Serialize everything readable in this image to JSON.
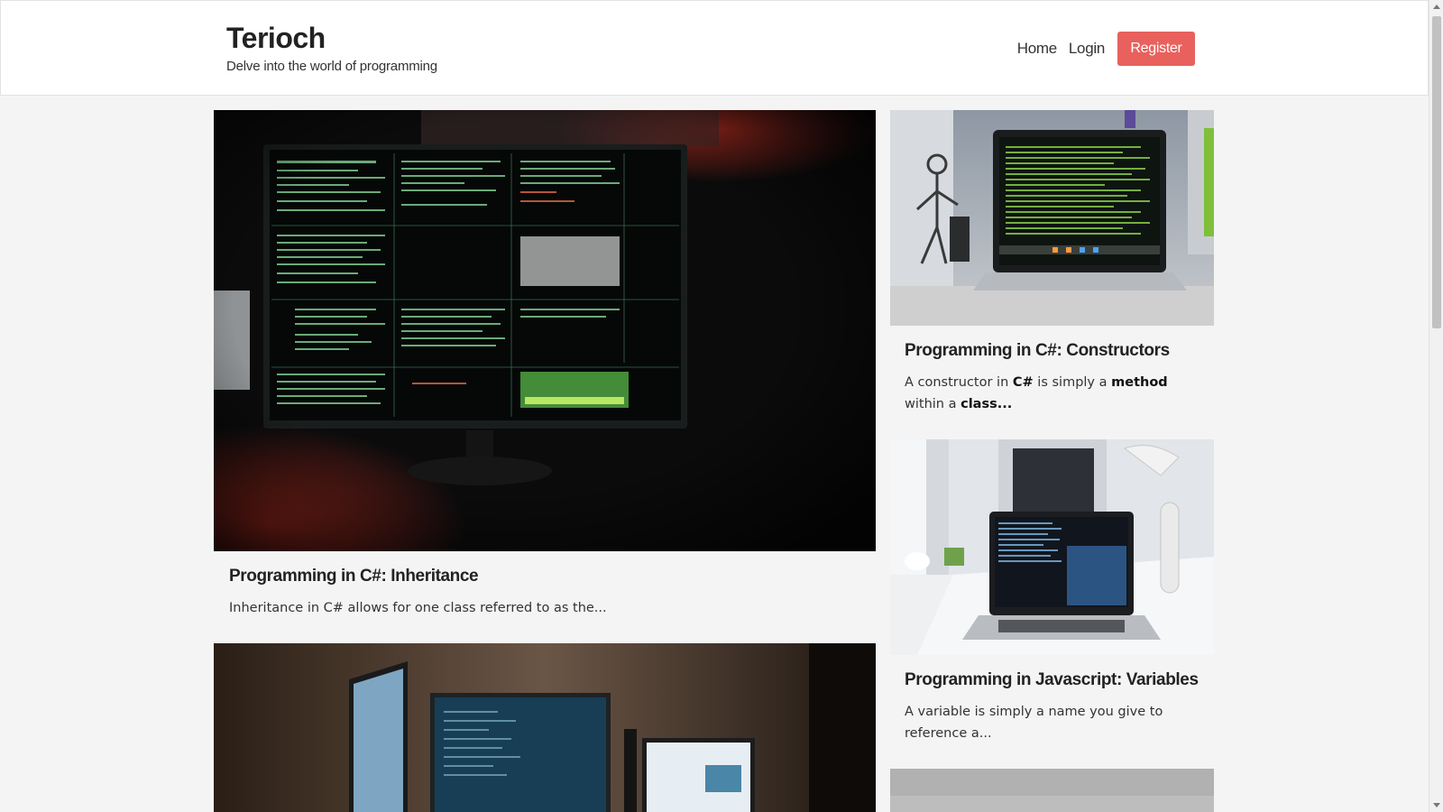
{
  "site": {
    "title": "Terioch",
    "tagline": "Delve into the world of programming"
  },
  "nav": {
    "home": "Home",
    "login": "Login",
    "register": "Register"
  },
  "colors": {
    "accent": "#e8615d",
    "background": "#f4f4f4"
  },
  "posts": [
    {
      "title": "Programming in C#: Inheritance",
      "excerpt": "Inheritance in C# allows for one class referred to as the...",
      "image_icon": "monitor-terminal-photo"
    },
    {
      "title": "Programming in C#: Constructors",
      "excerpt_parts": {
        "p1": "A constructor in ",
        "b1": "C#",
        "p2": " is simply a ",
        "b2": "method",
        "p3": " within a ",
        "b3": "class..."
      },
      "image_icon": "laptop-code-photo"
    },
    {
      "title": "Programming in Javascript: Variables",
      "excerpt": "A variable is simply a name you give to reference a...",
      "image_icon": "laptop-desk-photo"
    },
    {
      "image_icon": "multi-monitor-photo"
    },
    {
      "image_icon": "gray-wall-photo"
    }
  ]
}
